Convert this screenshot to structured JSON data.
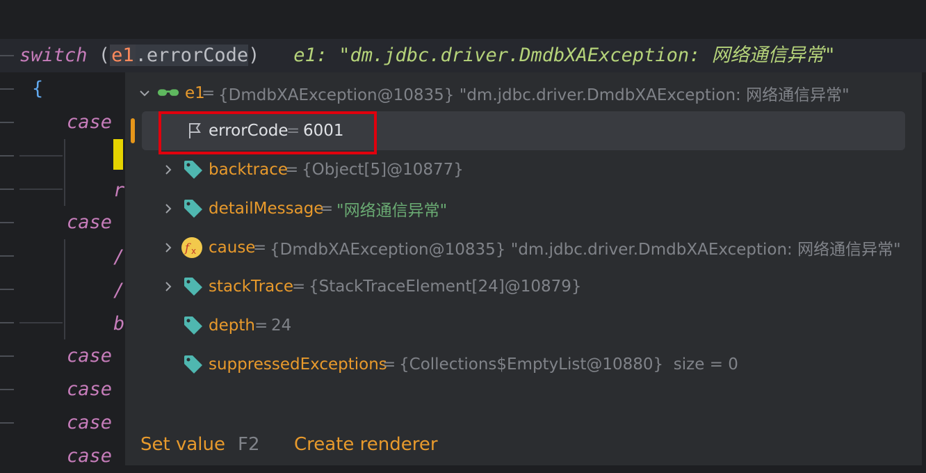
{
  "editor": {
    "switch_kw": "switch",
    "open_paren": " (",
    "var_e1": "e1",
    "dot_error": ".errorCode",
    "close_paren": ")",
    "inline_hint": "e1: \"dm.jdbc.driver.DmdbXAException: 网络通信异常\"",
    "brace": "{",
    "case_labels": [
      "case",
      "case",
      "case",
      "case",
      "case",
      "case"
    ],
    "peek_r": "r",
    "peek_slash1": "/",
    "peek_slash2": "/",
    "peek_b": "b"
  },
  "popup": {
    "root": {
      "name": "e1",
      "eq": " = ",
      "value": "{DmdbXAException@10835} \"dm.jdbc.driver.DmdbXAException: 网络通信异常\""
    },
    "rows": [
      {
        "name": "errorCode",
        "eq": " = ",
        "value": "6001"
      },
      {
        "name": "backtrace",
        "eq": " = ",
        "value": "{Object[5]@10877}"
      },
      {
        "name": "detailMessage",
        "eq": " = ",
        "value": "\"网络通信异常\""
      },
      {
        "name": "cause",
        "eq": " = ",
        "value": "{DmdbXAException@10835} \"dm.jdbc.driver.DmdbXAException: 网络通信异常\""
      },
      {
        "name": "stackTrace",
        "eq": " = ",
        "value": "{StackTraceElement[24]@10879}"
      },
      {
        "name": "depth",
        "eq": " = ",
        "value": "24"
      },
      {
        "name": "suppressedExceptions",
        "eq": " = ",
        "value": "{Collections$EmptyList@10880}  size = 0"
      }
    ],
    "footer": {
      "set_value": "Set value",
      "set_value_key": "F2",
      "create_renderer": "Create renderer"
    }
  },
  "colors": {
    "background": "#1e1f22",
    "popup_bg": "#2b2d30",
    "field_name": "#e89a2c",
    "string_value": "#6aab73",
    "highlight_box": "#e0000d"
  }
}
